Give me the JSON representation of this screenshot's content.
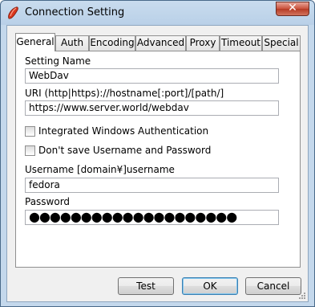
{
  "window": {
    "title": "Connection Setting",
    "close_glyph": "✕"
  },
  "tabs": [
    {
      "label": "General"
    },
    {
      "label": "Auth"
    },
    {
      "label": "Encoding"
    },
    {
      "label": "Advanced"
    },
    {
      "label": "Proxy"
    },
    {
      "label": "Timeout"
    },
    {
      "label": "Special"
    }
  ],
  "general": {
    "setting_name_label": "Setting Name",
    "setting_name_value": "WebDav",
    "uri_label": "URI  (http|https)://hostname[:port]/[path/]",
    "uri_value": "https://www.server.world/webdav",
    "integrated_auth_label": "Integrated Windows Authentication",
    "dont_save_label": "Don't save Username and Password",
    "username_label": "Username  [domain¥]username",
    "username_value": "fedora",
    "password_label": "Password",
    "password_value": "●●●●●●●●●●●●●●●●●●●●"
  },
  "buttons": {
    "test": "Test",
    "ok": "OK",
    "cancel": "Cancel"
  },
  "colors": {
    "title_bar": "#c4d8ec",
    "close_button": "#c9503a"
  }
}
